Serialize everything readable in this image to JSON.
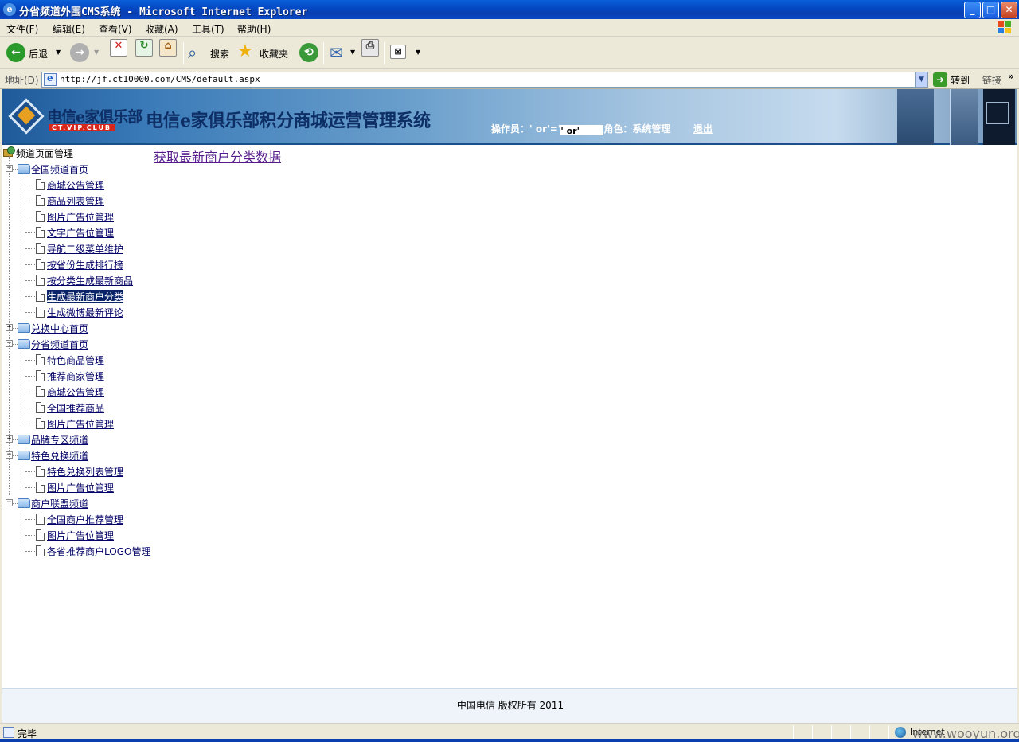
{
  "window": {
    "title": "分省频道外围CMS系统 - Microsoft Internet Explorer",
    "min": "_",
    "max": "□",
    "close": "✕"
  },
  "menu": [
    "文件(F)",
    "编辑(E)",
    "查看(V)",
    "收藏(A)",
    "工具(T)",
    "帮助(H)"
  ],
  "toolbar": {
    "back": "后退",
    "search": "搜索",
    "favorites": "收藏夹"
  },
  "address": {
    "label": "地址(D)",
    "url": "http://jf.ct10000.com/CMS/default.aspx",
    "go": "转到",
    "links": "链接"
  },
  "banner": {
    "logo_name": "电信e家俱乐部",
    "logo_sub": "CT.VIP.CLUB",
    "system_title": "电信e家俱乐部积分商城运营管理系统",
    "operator_label": "操作员：' or'='",
    "operator_value": "' or'",
    "role_label": "角色：系统管理",
    "logout": "退出"
  },
  "tree": {
    "root": "频道页面管理",
    "groups": [
      {
        "label": "全国频道首页",
        "expanded": true,
        "items": [
          "商城公告管理",
          "商品列表管理",
          "图片广告位管理",
          "文字广告位管理",
          "导航二级菜单维护",
          "按省份生成排行榜",
          "按分类生成最新商品",
          "生成最新商户分类",
          "生成微博最新评论"
        ]
      },
      {
        "label": "兑换中心首页",
        "expanded": false,
        "items": []
      },
      {
        "label": "分省频道首页",
        "expanded": true,
        "items": [
          "特色商品管理",
          "推荐商家管理",
          "商城公告管理",
          "全国推荐商品",
          "图片广告位管理"
        ]
      },
      {
        "label": "品牌专区频道",
        "expanded": false,
        "items": []
      },
      {
        "label": "特色兑换频道",
        "expanded": true,
        "items": [
          "特色兑换列表管理",
          "图片广告位管理"
        ]
      },
      {
        "label": "商户联盟频道",
        "expanded": true,
        "items": [
          "全国商户推荐管理",
          "图片广告位管理",
          "各省推荐商户LOGO管理"
        ]
      }
    ],
    "selected": "生成最新商户分类"
  },
  "content": {
    "action_link": "获取最新商户分类数据"
  },
  "footer": {
    "copyright": "中国电信 版权所有 2011"
  },
  "status": {
    "text": "完毕",
    "zone": "Internet"
  },
  "watermark": "www.wooyun.org"
}
